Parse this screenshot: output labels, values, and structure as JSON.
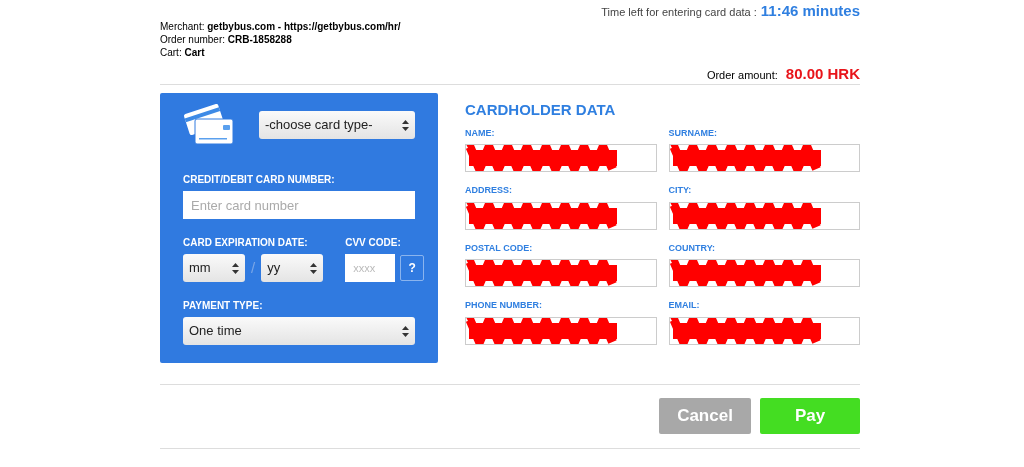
{
  "timer": {
    "label": "Time left for entering card data :",
    "value": "11:46 minutes"
  },
  "order_info": [
    "Merchant: **getbybus.com - https://getbybus.com/hr/**",
    "Order number: **CRB-1858288**",
    "Cart: **Cart**"
  ],
  "order_amount": {
    "label": "Order amount:",
    "value": "80.00 HRK"
  },
  "card_panel": {
    "card_type": {
      "value": "-choose card type-"
    },
    "card_number": {
      "label": "CREDIT/DEBIT CARD NUMBER:",
      "placeholder": "Enter card number"
    },
    "expiration": {
      "label": "CARD EXPIRATION DATE:",
      "month": "mm",
      "separator": "/",
      "year": "yy"
    },
    "cvv": {
      "label": "CVV CODE:",
      "placeholder": "xxxx",
      "help": "?"
    },
    "payment_type": {
      "label": "PAYMENT TYPE:",
      "value": "One time"
    }
  },
  "cardholder": {
    "title": "CARDHOLDER DATA",
    "fields": [
      {
        "label": "NAME:",
        "redacted": true
      },
      {
        "label": "SURNAME:",
        "redacted": true
      },
      {
        "label": "ADDRESS:",
        "redacted": true
      },
      {
        "label": "CITY:",
        "redacted": true
      },
      {
        "label": "POSTAL CODE:",
        "redacted": true
      },
      {
        "label": "COUNTRY:",
        "redacted": true
      },
      {
        "label": "PHONE NUMBER:",
        "redacted": true
      },
      {
        "label": "EMAIL:",
        "redacted": true
      }
    ]
  },
  "buttons": [
    {
      "label": "Cancel",
      "disabled": true
    },
    {
      "label": "Pay",
      "disabled": false
    }
  ]
}
